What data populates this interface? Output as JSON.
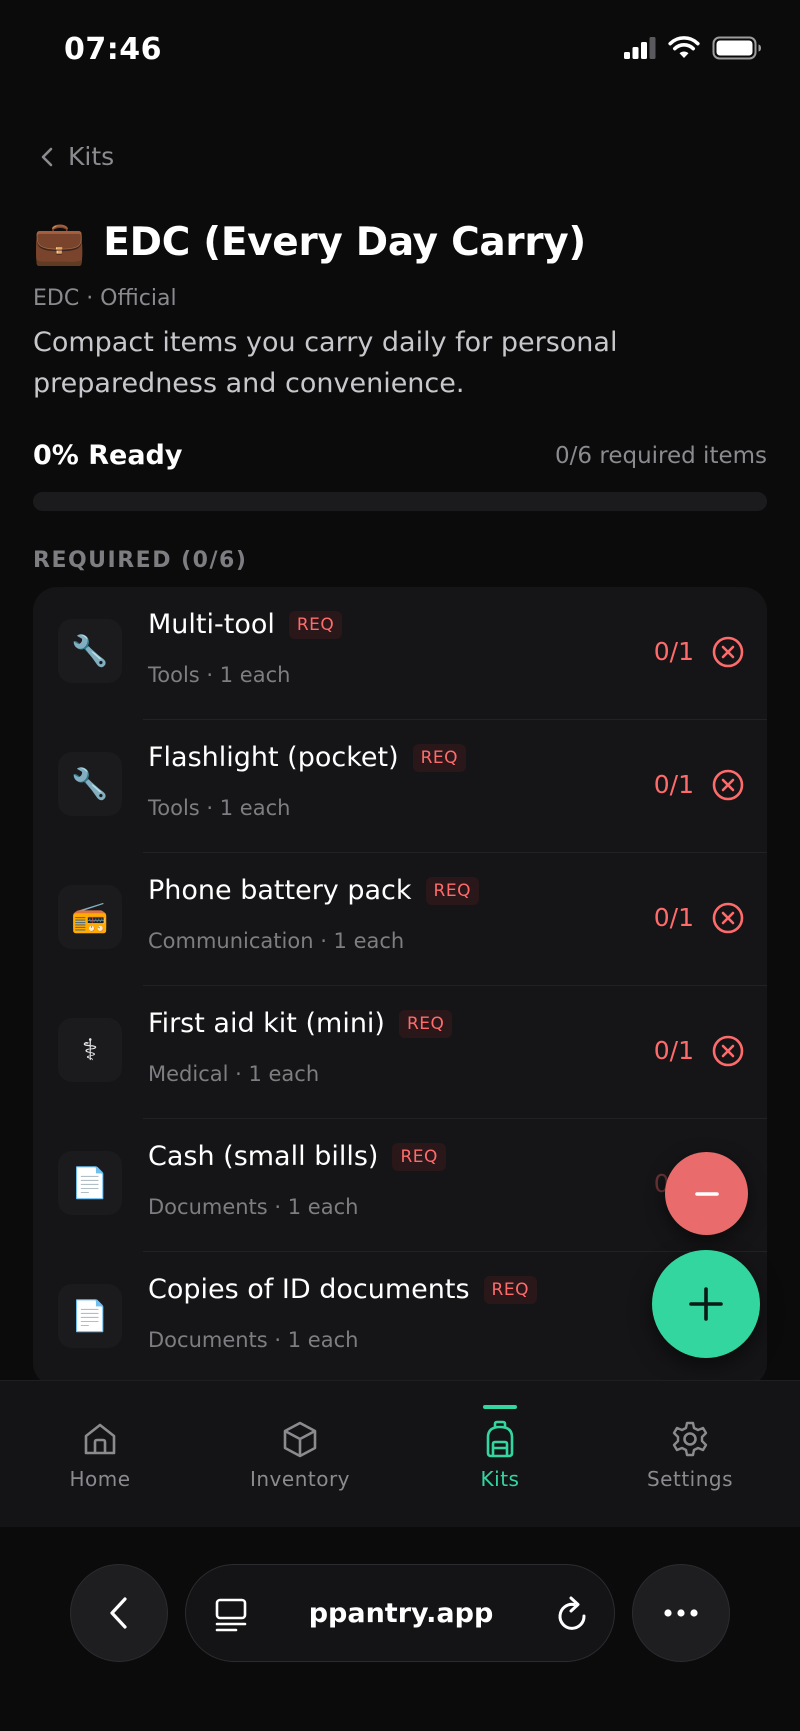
{
  "status_bar": {
    "time": "07:46"
  },
  "header": {
    "back_label": "Kits",
    "emoji": "💼",
    "title": "EDC (Every Day Carry)",
    "meta": "EDC · Official",
    "description": "Compact items you carry daily for personal preparedness and convenience."
  },
  "readiness": {
    "ready_label": "0% Ready",
    "required_count": "0/6 required items",
    "progress_fraction": 0
  },
  "section": {
    "label": "REQUIRED (0/6)"
  },
  "items": [
    {
      "name": "Multi-tool",
      "badge": "REQ",
      "sub": "Tools · 1 each",
      "count": "0/1",
      "icon": "wrench-icon",
      "glyph": "🔧"
    },
    {
      "name": "Flashlight (pocket)",
      "badge": "REQ",
      "sub": "Tools · 1 each",
      "count": "0/1",
      "icon": "wrench-icon",
      "glyph": "🔧"
    },
    {
      "name": "Phone battery pack",
      "badge": "REQ",
      "sub": "Communication · 1 each",
      "count": "0/1",
      "icon": "radio-icon",
      "glyph": "📻"
    },
    {
      "name": "First aid kit (mini)",
      "badge": "REQ",
      "sub": "Medical · 1 each",
      "count": "0/1",
      "icon": "medical-icon",
      "glyph": "⚕"
    },
    {
      "name": "Cash (small bills)",
      "badge": "REQ",
      "sub": "Documents · 1 each",
      "count": "0/1",
      "icon": "document-icon",
      "glyph": "📄"
    },
    {
      "name": "Copies of ID documents",
      "badge": "REQ",
      "sub": "Documents · 1 each",
      "count": "",
      "icon": "document-icon",
      "glyph": "📄"
    }
  ],
  "tabs": [
    {
      "label": "Home",
      "icon": "home-icon",
      "active": false
    },
    {
      "label": "Inventory",
      "icon": "box-icon",
      "active": false
    },
    {
      "label": "Kits",
      "icon": "backpack-icon",
      "active": true
    },
    {
      "label": "Settings",
      "icon": "gear-icon",
      "active": false
    }
  ],
  "browser": {
    "url": "ppantry.app"
  },
  "colors": {
    "accent": "#33d69f",
    "danger": "#ff6b6b",
    "background": "#0b0b0c",
    "card": "#151517"
  }
}
